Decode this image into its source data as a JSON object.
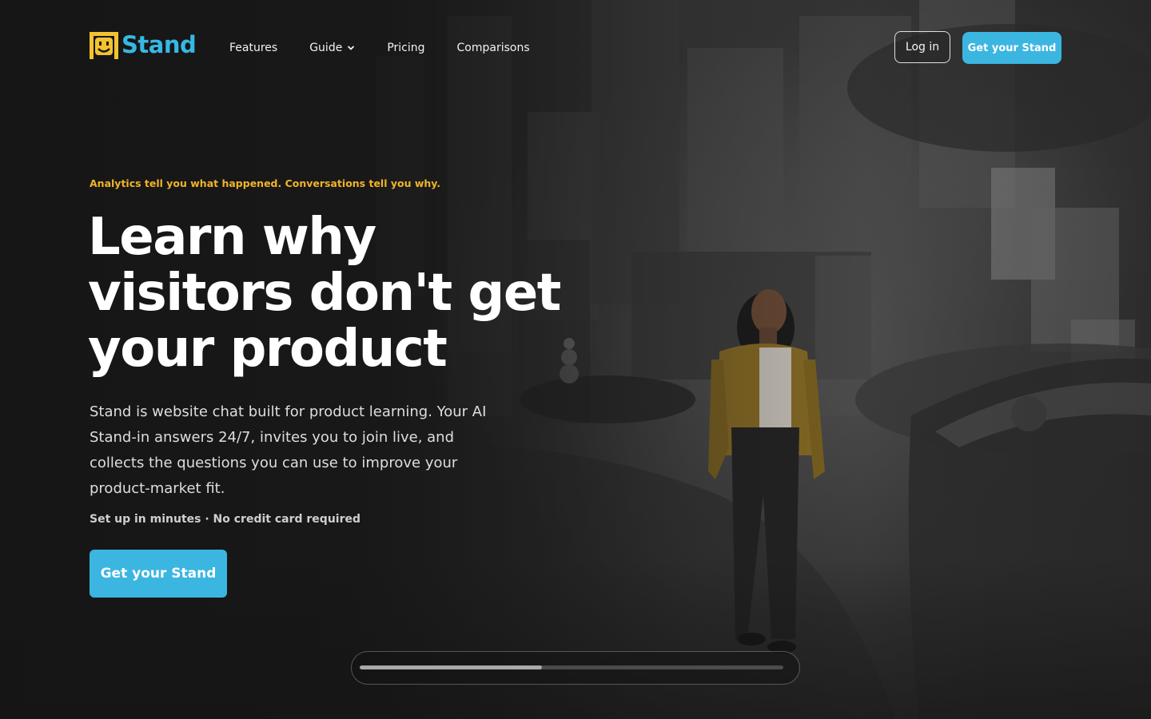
{
  "brand": {
    "name": "Stand",
    "logo_icon": "smiley-stand-logo-icon",
    "accent_color": "#37b8e4",
    "eyebrow_color": "#f0b429"
  },
  "nav": {
    "items": [
      {
        "label": "Features"
      },
      {
        "label": "Guide",
        "icon": "chevron-down-icon"
      },
      {
        "label": "Pricing"
      },
      {
        "label": "Comparisons"
      }
    ],
    "login_label": "Log in",
    "cta_label": "Get your Stand"
  },
  "hero": {
    "eyebrow": "Analytics tell you what happened. Conversations tell you why.",
    "headline": "Learn why visitors don't get your product",
    "subcopy": "Stand is website chat built for product learning. Your AI Stand-in answers 24/7, invites you to join live, and collects the questions you can use to improve your product-market fit.",
    "setup_note": "Set up in minutes · No credit card required",
    "cta_label": "Get your Stand",
    "background_image": "woman-walking-in-gallery-illustration"
  },
  "progress": {
    "fraction": 0.43
  }
}
